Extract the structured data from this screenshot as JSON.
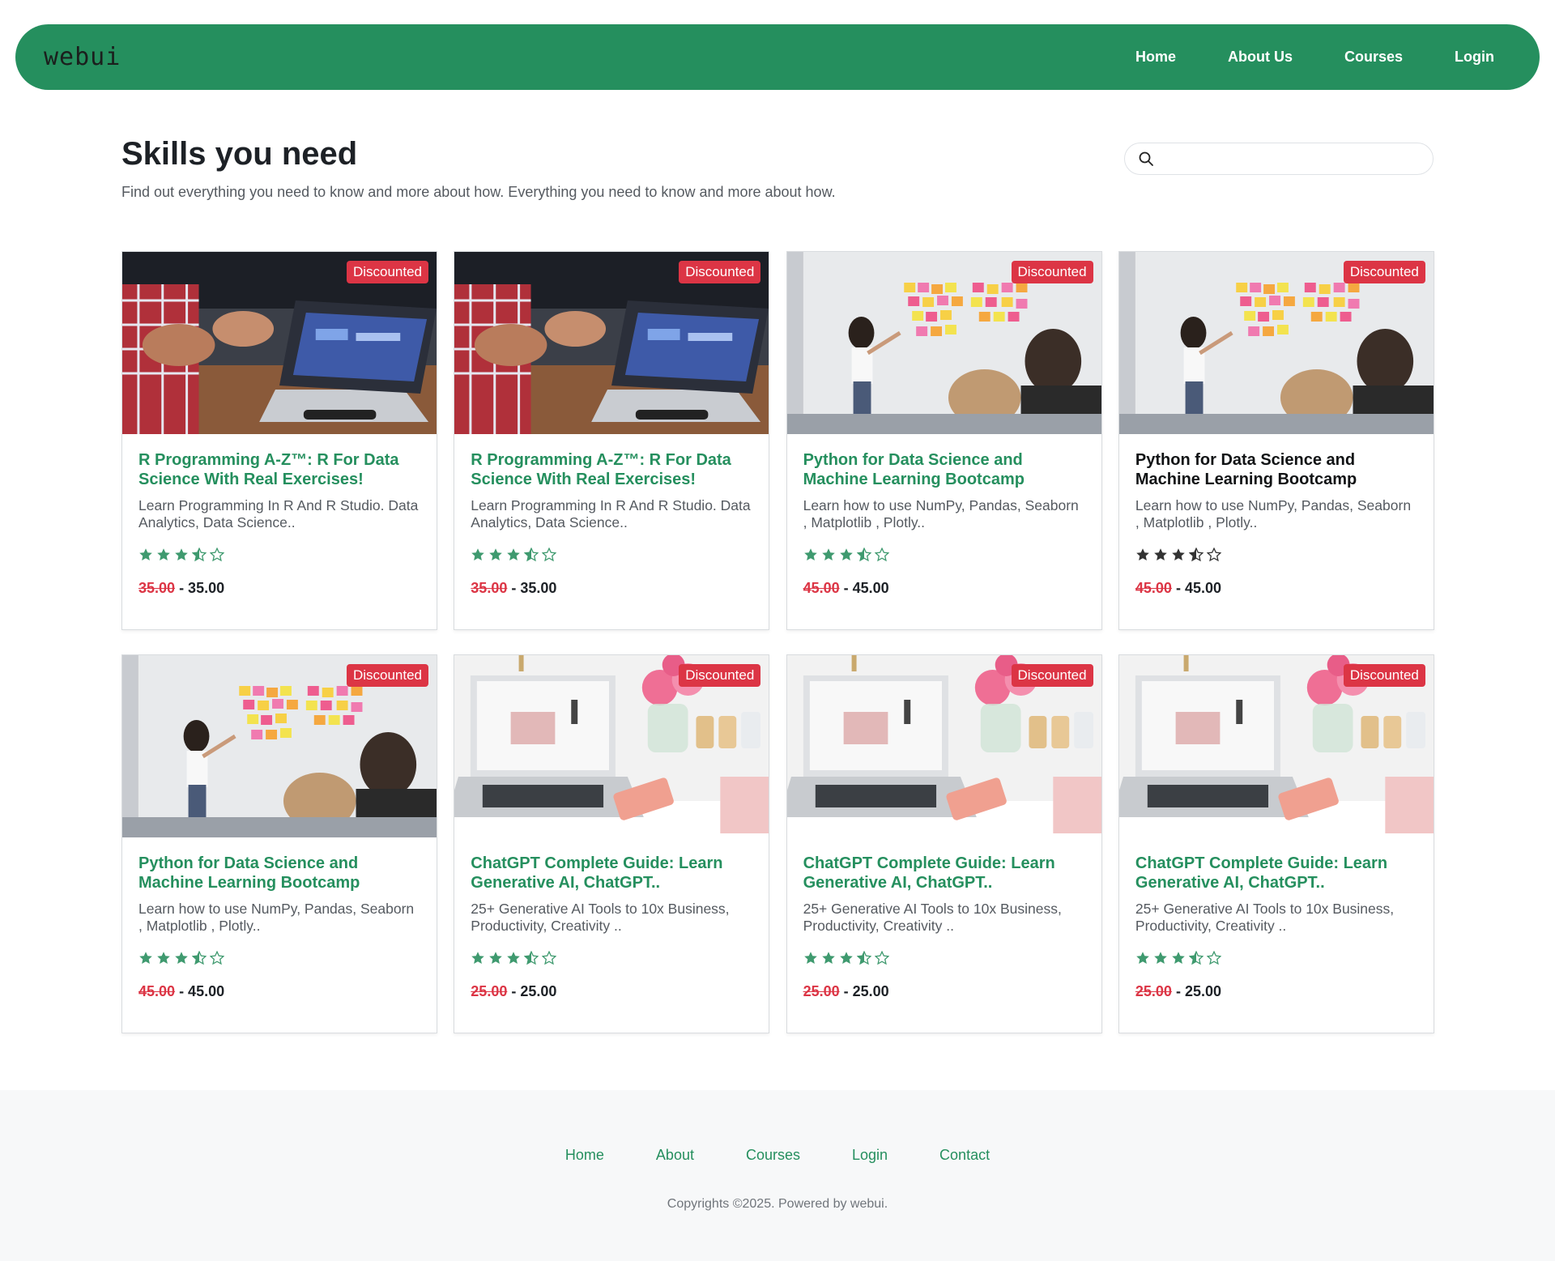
{
  "nav": {
    "brand": "webui",
    "links": [
      "Home",
      "About Us",
      "Courses",
      "Login"
    ]
  },
  "header": {
    "title": "Skills you need",
    "description": "Find out everything you need to know and more about how. Everything you need to know and more about how.",
    "search_placeholder": ""
  },
  "cards": [
    {
      "image": "meeting-laptop-photo",
      "badge": "Discounted",
      "title": "R Programming A-Z™: R For Data Science With Real Exercises!",
      "desc": "Learn Programming In R And R Studio. Data Analytics, Data Science..",
      "rating": 3.5,
      "old_price": "35.00",
      "price": "- 35.00"
    },
    {
      "image": "meeting-laptop-photo",
      "badge": "Discounted",
      "title": "R Programming A-Z™: R For Data Science With Real Exercises!",
      "desc": "Learn Programming In R And R Studio. Data Analytics, Data Science..",
      "rating": 3.5,
      "old_price": "35.00",
      "price": "- 35.00"
    },
    {
      "image": "whiteboard-sticky-notes-photo",
      "badge": "Discounted",
      "title": "Python for Data Science and Machine Learning Bootcamp",
      "desc": "Learn how to use NumPy, Pandas, Seaborn , Matplotlib , Plotly..",
      "rating": 3.5,
      "old_price": "45.00",
      "price": "- 45.00"
    },
    {
      "image": "whiteboard-sticky-notes-photo",
      "badge": "Discounted",
      "title": "Python for Data Science and Machine Learning Bootcamp",
      "desc": "Learn how to use NumPy, Pandas, Seaborn , Matplotlib , Plotly..",
      "rating": 3.5,
      "old_price": "45.00",
      "price": "- 45.00",
      "hover": true
    },
    {
      "image": "whiteboard-sticky-notes-photo",
      "badge": "Discounted",
      "title": "Python for Data Science and Machine Learning Bootcamp",
      "desc": "Learn how to use NumPy, Pandas, Seaborn , Matplotlib , Plotly..",
      "rating": 3.5,
      "old_price": "45.00",
      "price": "- 45.00"
    },
    {
      "image": "laptop-flowers-desk-photo",
      "badge": "Discounted",
      "title": "ChatGPT Complete Guide: Learn Generative AI, ChatGPT..",
      "desc": "25+ Generative AI Tools to 10x Business, Productivity, Creativity ..",
      "rating": 3.5,
      "old_price": "25.00",
      "price": "- 25.00"
    },
    {
      "image": "laptop-flowers-desk-photo",
      "badge": "Discounted",
      "title": "ChatGPT Complete Guide: Learn Generative AI, ChatGPT..",
      "desc": "25+ Generative AI Tools to 10x Business, Productivity, Creativity ..",
      "rating": 3.5,
      "old_price": "25.00",
      "price": "- 25.00"
    },
    {
      "image": "laptop-flowers-desk-photo",
      "badge": "Discounted",
      "title": "ChatGPT Complete Guide: Learn Generative AI, ChatGPT..",
      "desc": "25+ Generative AI Tools to 10x Business, Productivity, Creativity ..",
      "rating": 3.5,
      "old_price": "25.00",
      "price": "- 25.00"
    }
  ],
  "footer": {
    "links": [
      "Home",
      "About",
      "Courses",
      "Login",
      "Contact"
    ],
    "copyright": "Copyrights ©2025. Powered by webui."
  },
  "colors": {
    "primary": "#258f5e",
    "danger": "#dc3545",
    "star_green": "#3f9a6f",
    "star_dark": "#333333"
  }
}
